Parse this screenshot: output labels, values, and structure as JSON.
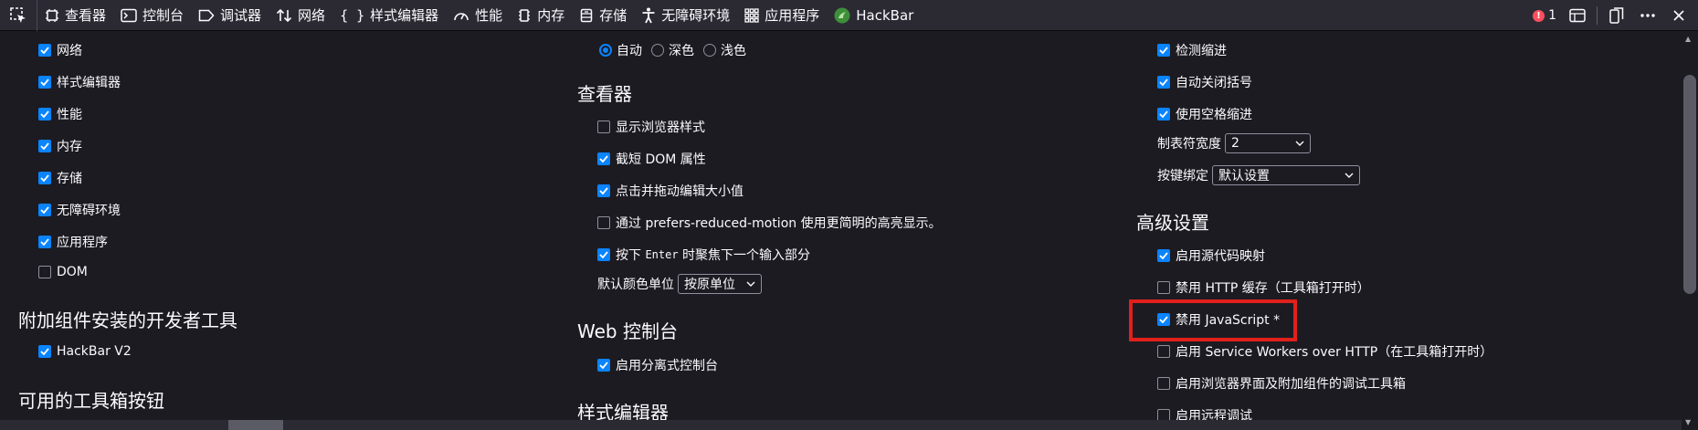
{
  "toolbar": {
    "tabs": [
      {
        "label": "查看器",
        "icon": "inspector-icon"
      },
      {
        "label": "控制台",
        "icon": "console-icon"
      },
      {
        "label": "调试器",
        "icon": "debugger-icon"
      },
      {
        "label": "网络",
        "icon": "network-icon"
      },
      {
        "label": "样式编辑器",
        "icon": "style-editor-icon"
      },
      {
        "label": "性能",
        "icon": "performance-icon"
      },
      {
        "label": "内存",
        "icon": "memory-icon"
      },
      {
        "label": "存储",
        "icon": "storage-icon"
      },
      {
        "label": "无障碍环境",
        "icon": "accessibility-icon"
      },
      {
        "label": "应用程序",
        "icon": "application-icon"
      },
      {
        "label": "HackBar",
        "icon": "hackbar-icon"
      }
    ],
    "error_count": "1"
  },
  "left": {
    "tool_items": [
      {
        "label": "网络",
        "checked": true
      },
      {
        "label": "样式编辑器",
        "checked": true
      },
      {
        "label": "性能",
        "checked": true
      },
      {
        "label": "内存",
        "checked": true
      },
      {
        "label": "存储",
        "checked": true
      },
      {
        "label": "无障碍环境",
        "checked": true
      },
      {
        "label": "应用程序",
        "checked": true
      },
      {
        "label": "DOM",
        "checked": false
      }
    ],
    "addon_heading": "附加组件安装的开发者工具",
    "addon_item": "HackBar V2",
    "buttons_heading": "可用的工具箱按钮"
  },
  "middle": {
    "theme_options": [
      "自动",
      "深色",
      "浅色"
    ],
    "inspector_heading": "查看器",
    "inspector_items": [
      {
        "label": "显示浏览器样式",
        "checked": false
      },
      {
        "label": "截短 DOM 属性",
        "checked": true
      },
      {
        "label": "点击并拖动编辑大小值",
        "checked": true
      },
      {
        "label": "通过 prefers-reduced-motion 使用更简明的高亮显示。",
        "checked": false
      }
    ],
    "enter_item": {
      "prefix": "按下 ",
      "key": "Enter",
      "suffix": " 时聚焦下一个输入部分",
      "checked": true
    },
    "color_unit_label": "默认颜色单位",
    "color_unit_value": "按原单位",
    "console_heading": "Web 控制台",
    "console_item": "启用分离式控制台",
    "style_heading": "样式编辑器"
  },
  "right": {
    "editor_items": [
      {
        "label": "检测缩进",
        "checked": true
      },
      {
        "label": "自动关闭括号",
        "checked": true
      },
      {
        "label": "使用空格缩进",
        "checked": true
      }
    ],
    "tab_width_label": "制表符宽度",
    "tab_width_value": "2",
    "keybinding_label": "按键绑定",
    "keybinding_value": "默认设置",
    "advanced_heading": "高级设置",
    "advanced_items": [
      {
        "label": "启用源代码映射",
        "checked": true
      },
      {
        "label": "禁用 HTTP 缓存（工具箱打开时）",
        "checked": false
      },
      {
        "label": "禁用 JavaScript *",
        "checked": true
      },
      {
        "label": "启用 Service Workers over HTTP（在工具箱打开时）",
        "checked": false
      },
      {
        "label": "启用浏览器界面及附加组件的调试工具箱",
        "checked": false
      },
      {
        "label": "启用远程调试",
        "checked": false
      }
    ]
  },
  "colors": {
    "accent": "#0a84ff",
    "background": "#1c1b22",
    "toolbar": "#2b2a33",
    "highlight": "#e0201b"
  }
}
